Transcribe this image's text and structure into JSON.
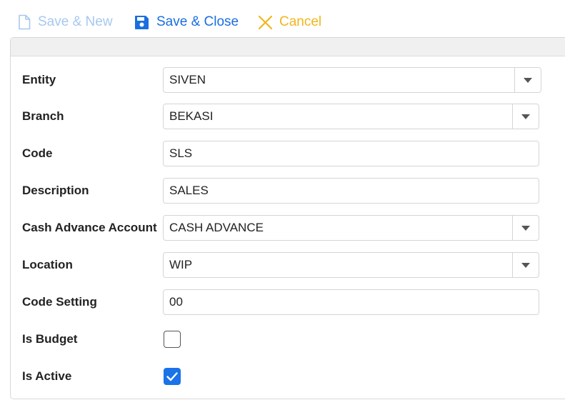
{
  "toolbar": {
    "save_new_label": "Save & New",
    "save_close_label": "Save & Close",
    "cancel_label": "Cancel"
  },
  "form": {
    "entity": {
      "label": "Entity",
      "value": "SIVEN"
    },
    "branch": {
      "label": "Branch",
      "value": "BEKASI"
    },
    "code": {
      "label": "Code",
      "value": "SLS"
    },
    "description": {
      "label": "Description",
      "value": "SALES"
    },
    "cash_advance_account": {
      "label": "Cash Advance Account",
      "value": "CASH ADVANCE"
    },
    "location": {
      "label": "Location",
      "value": "WIP"
    },
    "code_setting": {
      "label": "Code Setting",
      "value": "00"
    },
    "is_budget": {
      "label": "Is Budget",
      "checked": false
    },
    "is_active": {
      "label": "Is Active",
      "checked": true
    }
  },
  "colors": {
    "primary": "#1a6ee0",
    "disabled": "#a6c8f0",
    "cancel": "#f2b51c",
    "checkbox_checked": "#1a73e8"
  },
  "icons": {
    "save_new": "file-icon",
    "save_close": "floppy-disk-icon",
    "cancel": "x-icon",
    "dropdown": "caret-down-icon",
    "checkmark": "check-icon"
  }
}
